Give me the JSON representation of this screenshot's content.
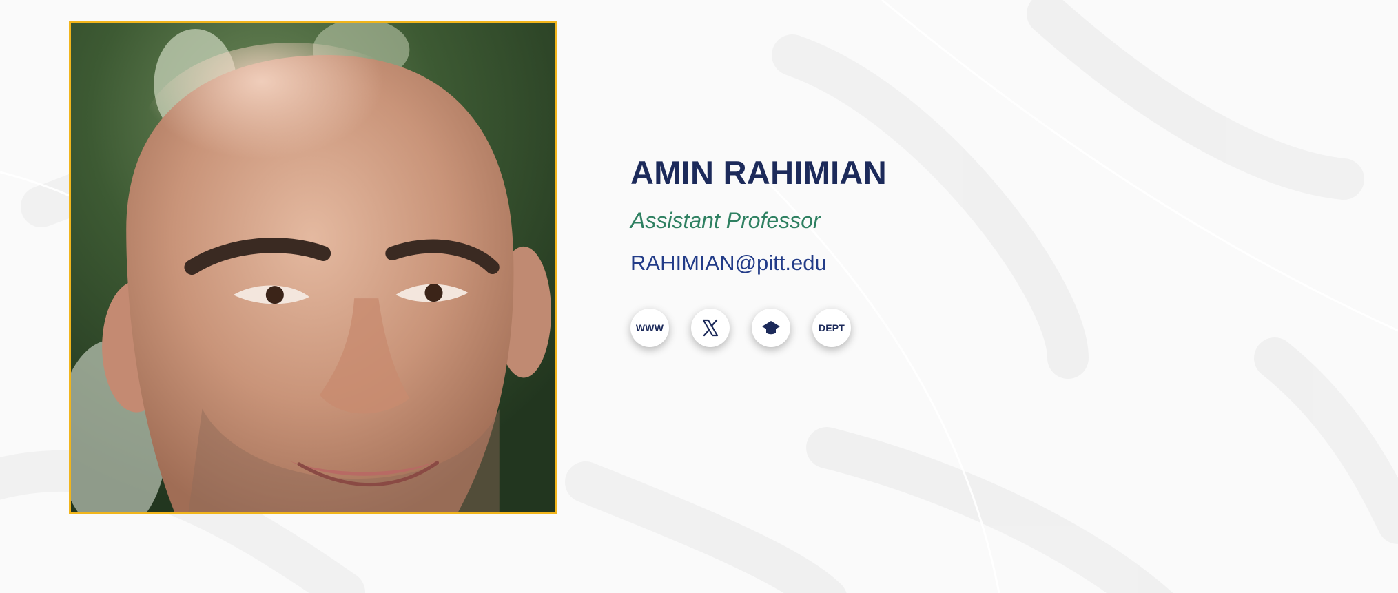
{
  "profile": {
    "name": "AMIN RAHIMIAN",
    "title": "Assistant Professor",
    "email": "RAHIMIAN@pitt.edu",
    "photo_alt": "Portrait of Amin Rahimian"
  },
  "socials": [
    {
      "label": "WWW",
      "icon": "globe-icon"
    },
    {
      "label": "",
      "icon": "x-logo-icon"
    },
    {
      "label": "",
      "icon": "graduation-cap-icon"
    },
    {
      "label": "DEPT",
      "icon": "department-icon"
    }
  ],
  "colors": {
    "name": "#1c2a5a",
    "title": "#2e8061",
    "email": "#233c88",
    "frame": "#f1b51c"
  }
}
